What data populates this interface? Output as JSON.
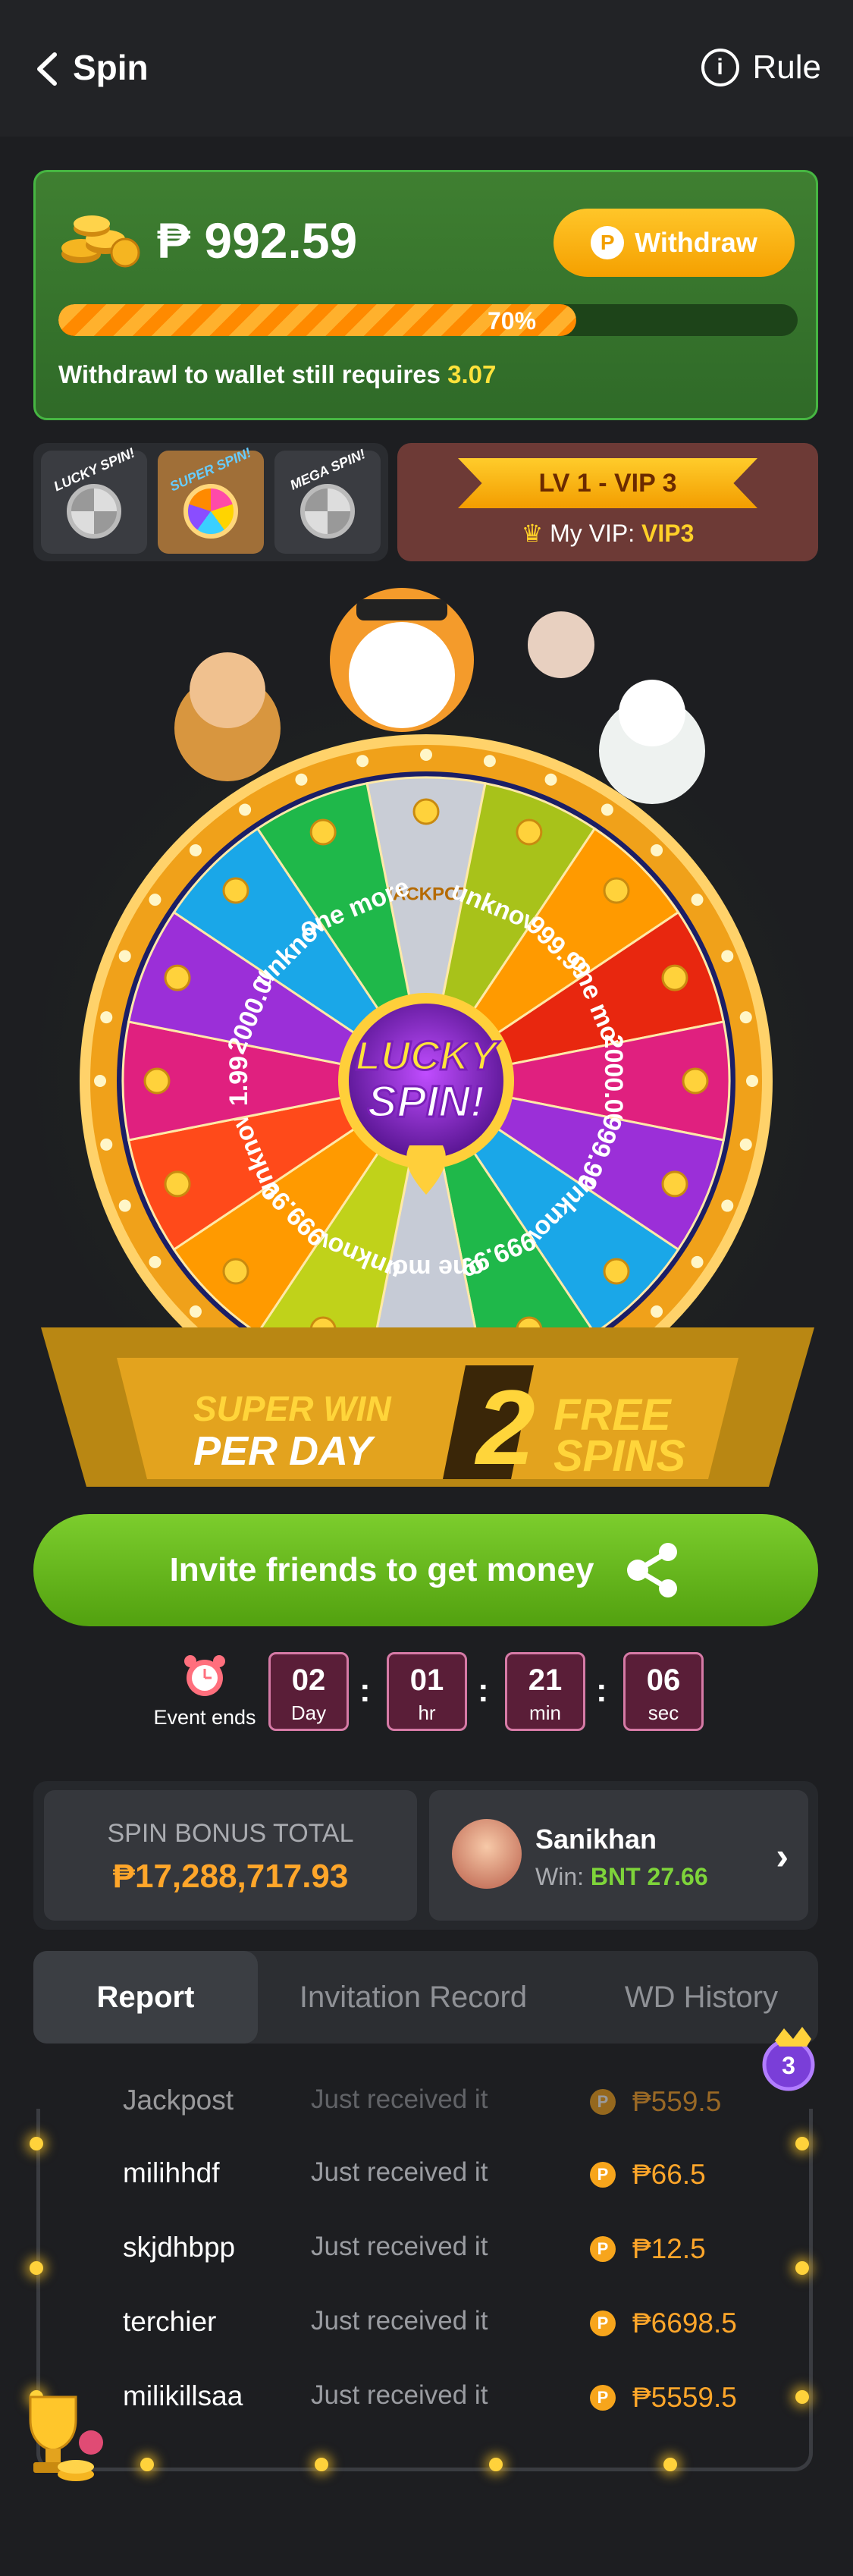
{
  "header": {
    "title": "Spin",
    "rule_label": "Rule",
    "rule_icon": "info-icon",
    "back_icon": "chevron-left-icon"
  },
  "balance": {
    "amount": "₱ 992.59",
    "withdraw_label": "Withdraw",
    "progress_pct": 70,
    "progress_text": "70%",
    "requirement_text": "Withdrawl to wallet still requires",
    "requirement_value": "3.07"
  },
  "spin_types": [
    {
      "label": "LUCKY SPIN!",
      "active": false
    },
    {
      "label": "SUPER SPIN!",
      "active": true
    },
    {
      "label": "MEGA SPIN!",
      "active": false
    }
  ],
  "vip": {
    "level": "LV 1 - VIP 3",
    "my_label": "My VIP:",
    "my_value": "VIP3"
  },
  "wheel": {
    "center_line1": "LUCKY",
    "center_line2": "SPIN!",
    "segments": [
      "JACKPOT",
      "unknow",
      "999.99",
      "one more",
      "2000.00",
      "999.99",
      "unknow",
      "999.99",
      "one more",
      "unknow",
      "999.99",
      "unknow",
      "1.99",
      "2000.00",
      "unknow",
      "one more"
    ]
  },
  "banner": {
    "line1": "SUPER WIN",
    "line2": "PER DAY",
    "count": "2",
    "free": "FREE",
    "spins": "SPINS"
  },
  "invite": {
    "label": "Invite friends to get money"
  },
  "timer": {
    "label": "Event ends",
    "day": "02",
    "day_unit": "Day",
    "hr": "01",
    "hr_unit": "hr",
    "min": "21",
    "min_unit": "min",
    "sec": "06",
    "sec_unit": "sec"
  },
  "bonus": {
    "total_label": "SPIN BONUS TOTAL",
    "total_value": "₱17,288,717.93",
    "user_name": "Sanikhan",
    "win_label": "Win:",
    "win_value": "BNT 27.66"
  },
  "report_tabs": [
    "Report",
    "Invitation Record",
    "WD History"
  ],
  "records": [
    {
      "name": "Jackpost",
      "status": "Just received it",
      "amount": "₱559.5"
    },
    {
      "name": "milihhdf",
      "status": "Just received it",
      "amount": "₱66.5"
    },
    {
      "name": "skjdhbpp",
      "status": "Just received it",
      "amount": "₱12.5"
    },
    {
      "name": "terchier",
      "status": "Just received it",
      "amount": "₱6698.5"
    },
    {
      "name": "milikillsaa",
      "status": "Just received it",
      "amount": "₱5559.5"
    }
  ],
  "colors": {
    "accent_green": "#5fb21a",
    "gold": "#ffb400",
    "bg": "#1d1e21"
  }
}
